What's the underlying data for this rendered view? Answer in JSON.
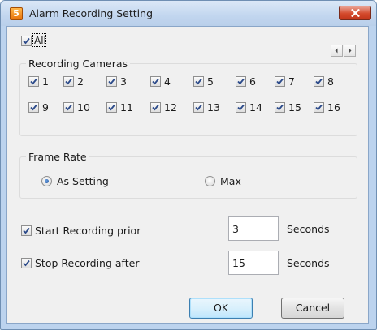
{
  "window": {
    "title": "Alarm Recording Setting",
    "app_icon_glyph": "5"
  },
  "all": {
    "label": "All",
    "checked": true
  },
  "cameras_group": {
    "title": "Recording Cameras",
    "cameras": [
      {
        "label": "1",
        "checked": true
      },
      {
        "label": "2",
        "checked": true
      },
      {
        "label": "3",
        "checked": true
      },
      {
        "label": "4",
        "checked": true
      },
      {
        "label": "5",
        "checked": true
      },
      {
        "label": "6",
        "checked": true
      },
      {
        "label": "7",
        "checked": true
      },
      {
        "label": "8",
        "checked": true
      },
      {
        "label": "9",
        "checked": true
      },
      {
        "label": "10",
        "checked": true
      },
      {
        "label": "11",
        "checked": true
      },
      {
        "label": "12",
        "checked": true
      },
      {
        "label": "13",
        "checked": true
      },
      {
        "label": "14",
        "checked": true
      },
      {
        "label": "15",
        "checked": true
      },
      {
        "label": "16",
        "checked": true
      }
    ]
  },
  "frame_rate": {
    "title": "Frame Rate",
    "options": [
      {
        "label": "As Setting",
        "selected": true
      },
      {
        "label": "Max",
        "selected": false
      }
    ]
  },
  "prior": {
    "label": "Start Recording prior",
    "checked": true,
    "value": "3",
    "unit": "Seconds"
  },
  "after": {
    "label": "Stop Recording after",
    "checked": true,
    "value": "15",
    "unit": "Seconds"
  },
  "buttons": {
    "ok": "OK",
    "cancel": "Cancel"
  },
  "colors": {
    "titlebar": "#c2d6ef",
    "close": "#d44a2c",
    "dialog_bg": "#f0f0f0",
    "accent": "#3c7fb1"
  }
}
